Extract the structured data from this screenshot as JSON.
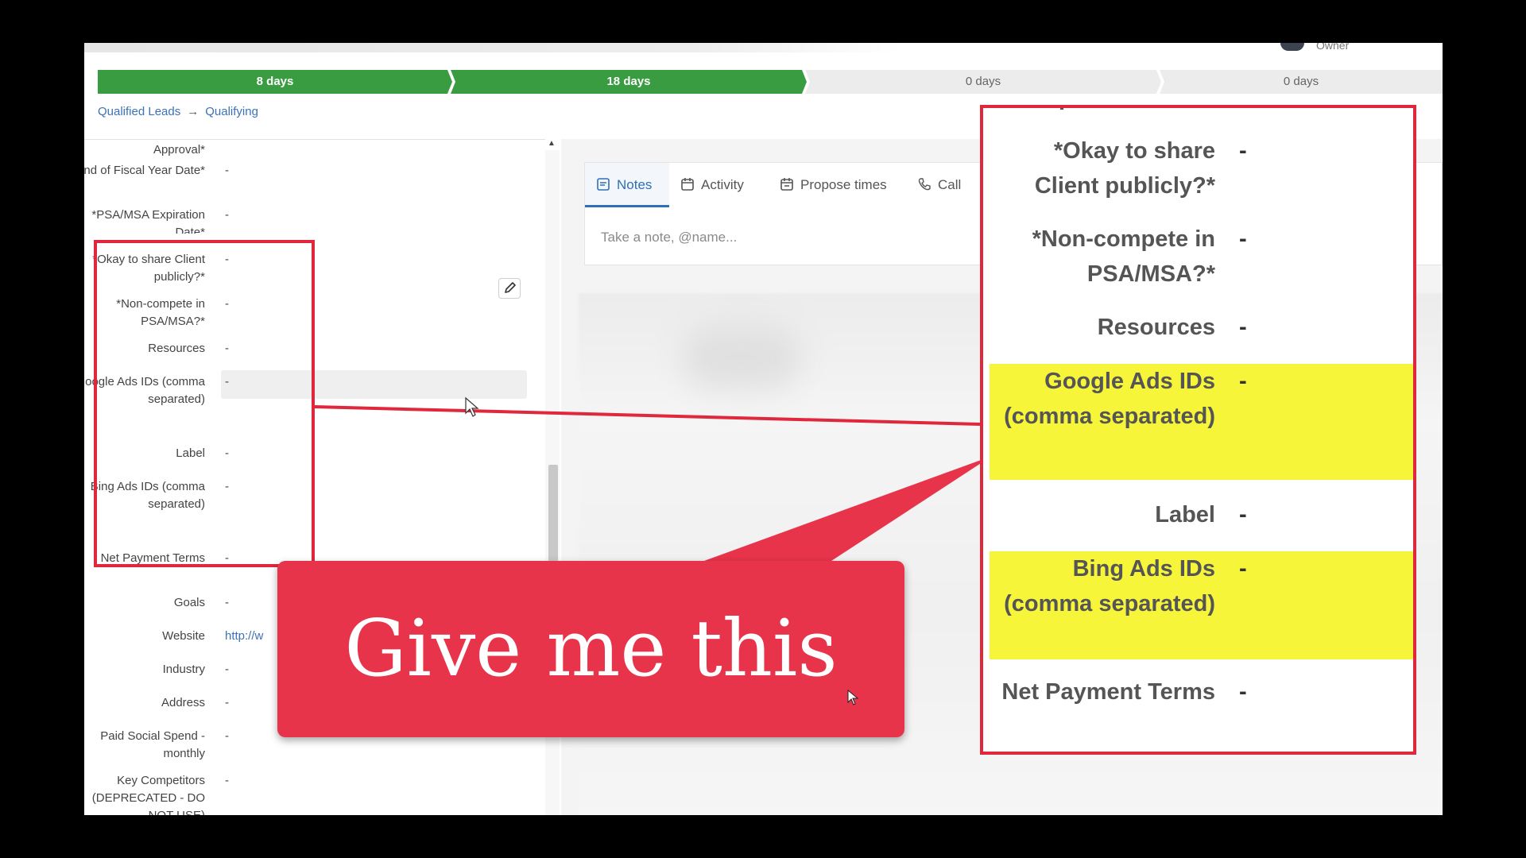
{
  "header": {
    "owner_label": "Owner"
  },
  "pipeline": {
    "stages": [
      {
        "label": "8 days",
        "state": "done"
      },
      {
        "label": "18 days",
        "state": "done"
      },
      {
        "label": "0 days",
        "state": "todo"
      },
      {
        "label": "0 days",
        "state": "todo"
      }
    ]
  },
  "breadcrumb": {
    "pipeline": "Qualified Leads",
    "arrow": "→",
    "stage": "Qualifying"
  },
  "fields": {
    "approval": {
      "label": "Approval*",
      "value": ""
    },
    "fiscal": {
      "label": "*End of Fiscal Year Date*",
      "value": "-"
    },
    "psa_expiration": {
      "label": "*PSA/MSA Expiration Date*",
      "value": "-"
    },
    "okay_share": {
      "label": "*Okay to share Client publicly?*",
      "value": "-"
    },
    "non_compete": {
      "label": "*Non-compete in PSA/MSA?*",
      "value": "-"
    },
    "resources": {
      "label": "Resources",
      "value": "-"
    },
    "google_ads": {
      "label": "Google Ads IDs (comma separated)",
      "value": "-"
    },
    "label": {
      "label": "Label",
      "value": "-"
    },
    "bing_ads": {
      "label": "Bing Ads IDs (comma separated)",
      "value": "-"
    },
    "net_payment": {
      "label": "Net Payment Terms",
      "value": "-"
    },
    "goals": {
      "label": "Goals",
      "value": "-"
    },
    "website": {
      "label": "Website",
      "value": "http://w"
    },
    "industry": {
      "label": "Industry",
      "value": "-"
    },
    "address": {
      "label": "Address",
      "value": "-"
    },
    "paid_social": {
      "label": "Paid Social Spend - monthly",
      "value": "-"
    },
    "competitors": {
      "label": "Key Competitors (DEPRECATED - DO NOT USE)",
      "value": "-"
    }
  },
  "notes": {
    "tabs": [
      {
        "label": "Notes",
        "icon": "notes-icon",
        "active": true
      },
      {
        "label": "Activity",
        "icon": "calendar-icon",
        "active": false
      },
      {
        "label": "Propose times",
        "icon": "propose-times-icon",
        "active": false
      },
      {
        "label": "Call",
        "icon": "phone-icon",
        "active": false
      }
    ],
    "placeholder": "Take a note, @name..."
  },
  "callout": {
    "rows": [
      {
        "label": "*Okay to share Client publicly?*",
        "value": "-",
        "highlight": false
      },
      {
        "label": "*Non-compete in PSA/MSA?*",
        "value": "-",
        "highlight": false
      },
      {
        "label": "Resources",
        "value": "-",
        "highlight": false
      },
      {
        "label": "Google Ads IDs (comma separated)",
        "value": "-",
        "highlight": true
      },
      {
        "label": "Label",
        "value": "-",
        "highlight": false
      },
      {
        "label": "Bing Ads IDs (comma separated)",
        "value": "-",
        "highlight": true
      },
      {
        "label": "Net Payment Terms",
        "value": "-",
        "highlight": false
      }
    ]
  },
  "banner": {
    "text": "Give me this"
  },
  "colors": {
    "stage_done": "#3a9c41",
    "accent_red": "#e0283d",
    "highlight_yellow": "#f6f53a",
    "link_blue": "#3b72b8"
  }
}
